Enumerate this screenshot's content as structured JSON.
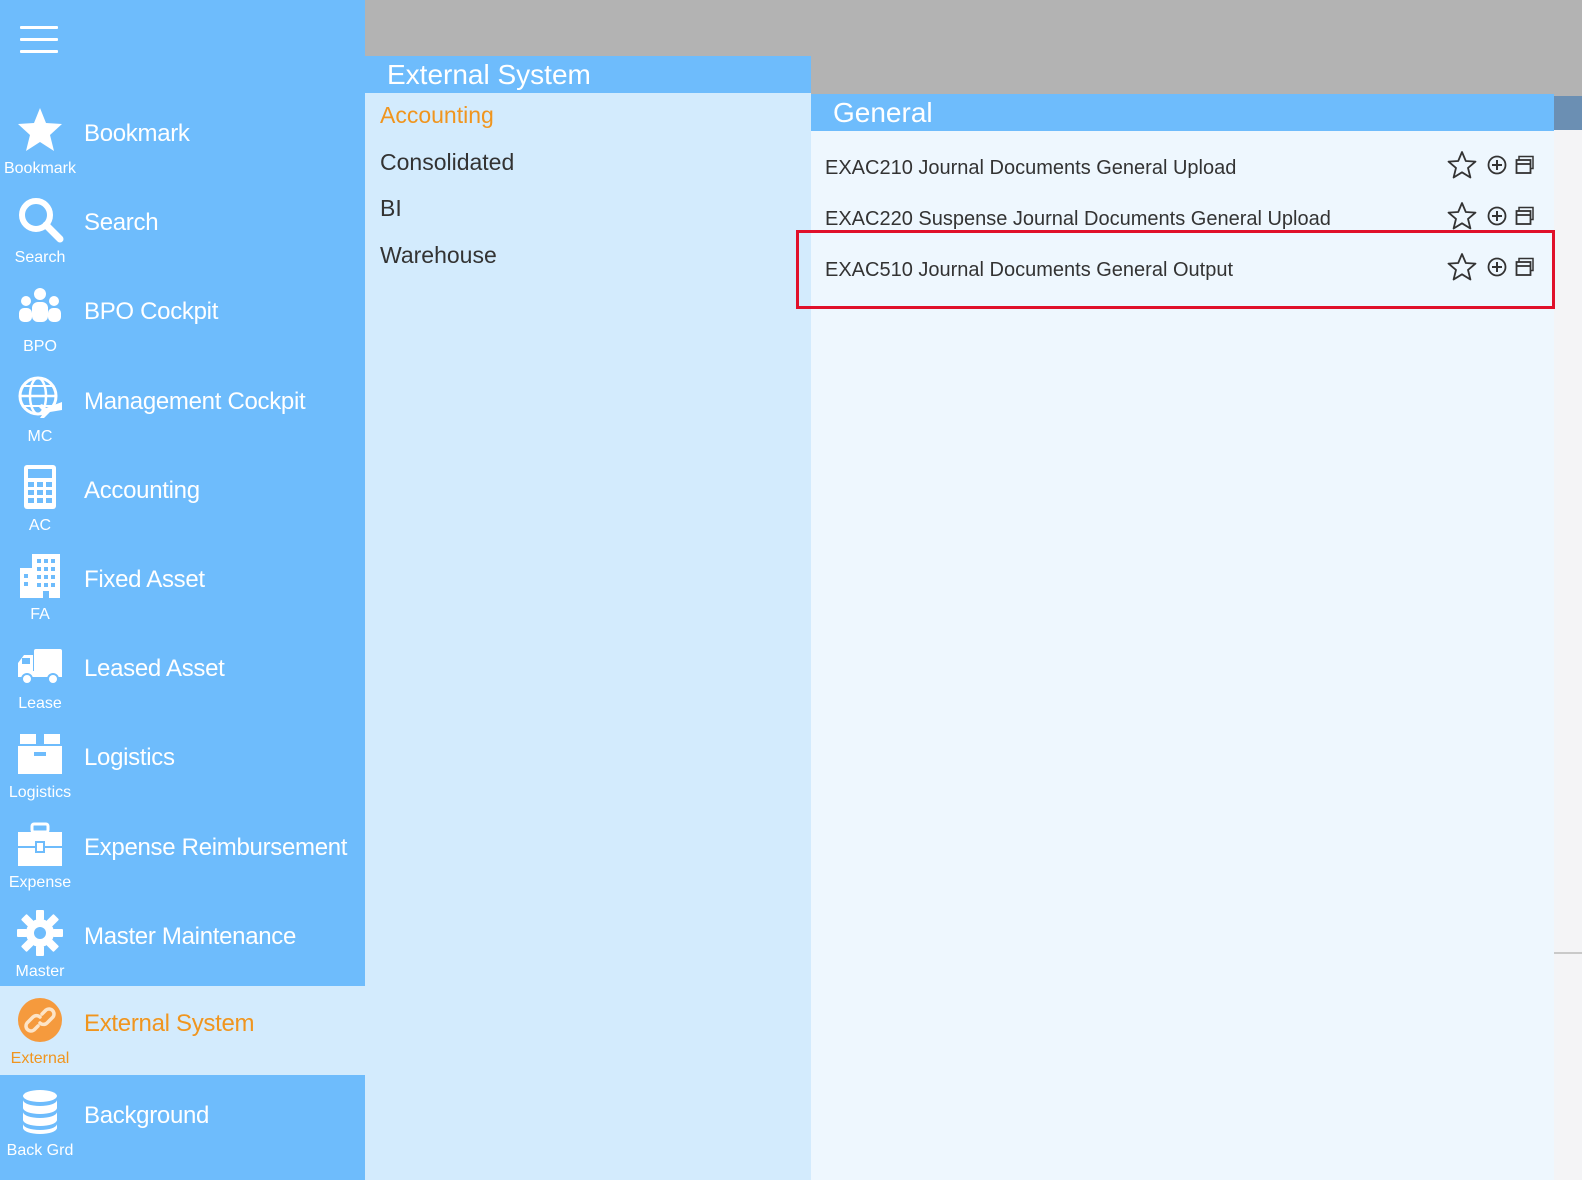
{
  "sidebar": {
    "items": [
      {
        "key": "bookmark",
        "label": "Bookmark",
        "short": "Bookmark",
        "icon": "star-icon"
      },
      {
        "key": "search",
        "label": "Search",
        "short": "Search",
        "icon": "magnifier-icon"
      },
      {
        "key": "bpo",
        "label": "BPO Cockpit",
        "short": "BPO",
        "icon": "people-group-icon"
      },
      {
        "key": "mc",
        "label": "Management Cockpit",
        "short": "MC",
        "icon": "globe-plane-icon"
      },
      {
        "key": "ac",
        "label": "Accounting",
        "short": "AC",
        "icon": "calculator-icon"
      },
      {
        "key": "fa",
        "label": "Fixed Asset",
        "short": "FA",
        "icon": "building-icon"
      },
      {
        "key": "lease",
        "label": "Leased Asset",
        "short": "Lease",
        "icon": "truck-icon"
      },
      {
        "key": "logistics",
        "label": "Logistics",
        "short": "Logistics",
        "icon": "box-icon"
      },
      {
        "key": "expense",
        "label": "Expense Reimbursement",
        "short": "Expense",
        "icon": "briefcase-icon"
      },
      {
        "key": "master",
        "label": "Master Maintenance",
        "short": "Master",
        "icon": "gear-icon"
      },
      {
        "key": "external",
        "label": "External System",
        "short": "External",
        "icon": "link-icon",
        "active": true
      },
      {
        "key": "background",
        "label": "Background",
        "short": "Back Grd",
        "icon": "database-icon"
      }
    ]
  },
  "category_panel": {
    "title": "External System",
    "items": [
      "Accounting",
      "Consolidated",
      "BI",
      "Warehouse"
    ],
    "selected": "Accounting"
  },
  "program_panel": {
    "title": "General",
    "items": [
      {
        "label": "EXAC210 Journal Documents General Upload"
      },
      {
        "label": "EXAC220 Suspense Journal Documents General Upload"
      },
      {
        "label": "EXAC510 Journal Documents General Output",
        "highlighted": true
      }
    ]
  },
  "colors": {
    "sidebar_bg": "#6ebcfc",
    "panel_bg": "#d3ebfd",
    "accent_orange": "#f0951e",
    "highlight_red": "#e0102a"
  }
}
